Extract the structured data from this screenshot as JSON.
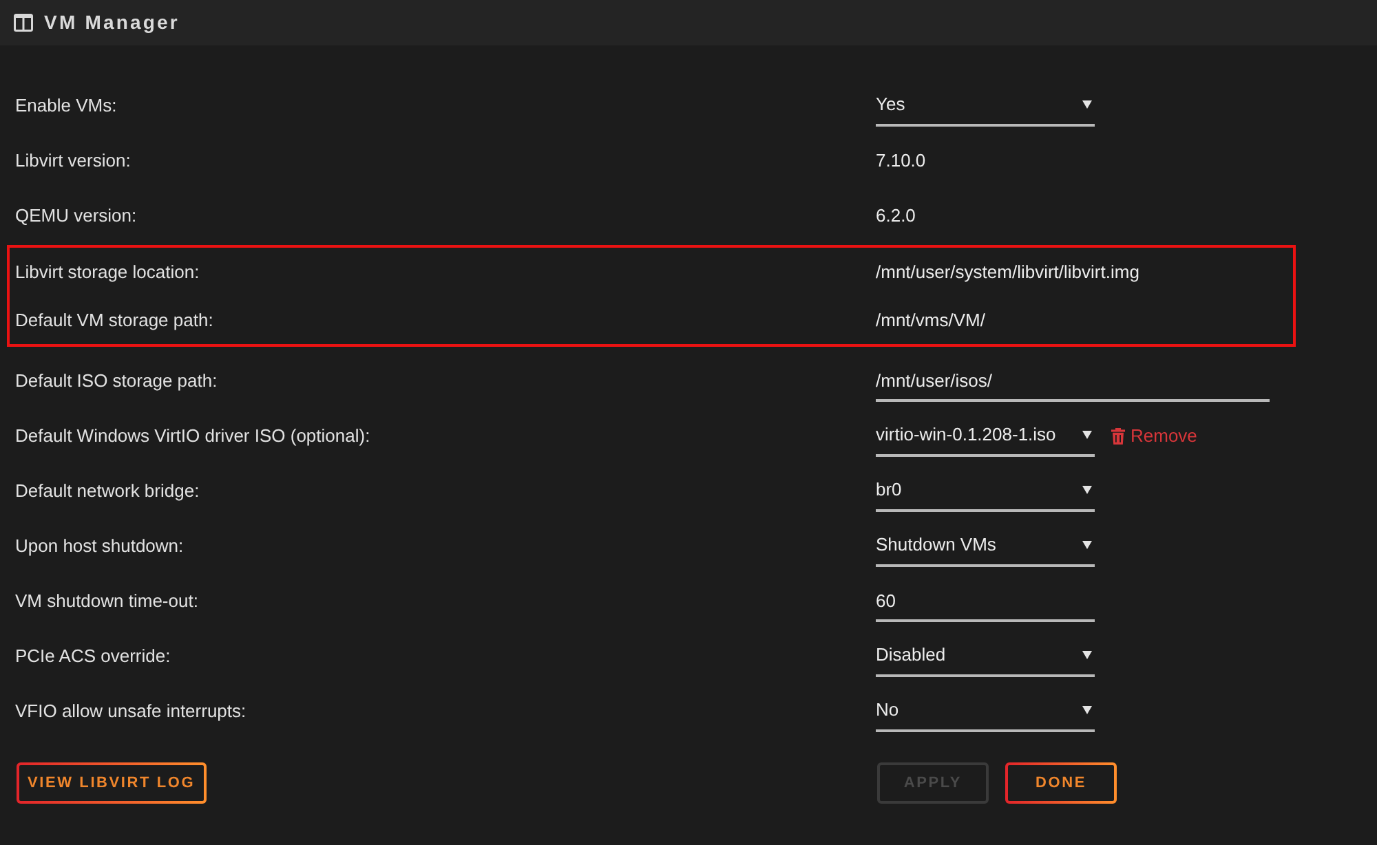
{
  "header": {
    "title": "VM Manager"
  },
  "settings": [
    {
      "label": "Enable VMs:",
      "kind": "select",
      "value": "Yes",
      "highlighted": false
    },
    {
      "label": "Libvirt version:",
      "kind": "static",
      "value": "7.10.0",
      "highlighted": false
    },
    {
      "label": "QEMU version:",
      "kind": "static",
      "value": "6.2.0",
      "highlighted": false
    },
    {
      "label": "Libvirt storage location:",
      "kind": "static",
      "value": "/mnt/user/system/libvirt/libvirt.img",
      "highlighted": true
    },
    {
      "label": "Default VM storage path:",
      "kind": "static",
      "value": "/mnt/vms/VM/",
      "highlighted": true
    },
    {
      "label": "Default ISO storage path:",
      "kind": "path",
      "value": "/mnt/user/isos/",
      "highlighted": false
    },
    {
      "label": "Default Windows VirtIO driver ISO (optional):",
      "kind": "select",
      "value": "virtio-win-0.1.208-1.iso",
      "highlighted": false,
      "action": {
        "label": "Remove"
      }
    },
    {
      "label": "Default network bridge:",
      "kind": "select",
      "value": "br0",
      "highlighted": false
    },
    {
      "label": "Upon host shutdown:",
      "kind": "select",
      "value": "Shutdown VMs",
      "highlighted": false
    },
    {
      "label": "VM shutdown time-out:",
      "kind": "input",
      "value": "60",
      "highlighted": false
    },
    {
      "label": "PCIe ACS override:",
      "kind": "select",
      "value": "Disabled",
      "highlighted": false
    },
    {
      "label": "VFIO allow unsafe interrupts:",
      "kind": "select",
      "value": "No",
      "highlighted": false
    }
  ],
  "buttons_left": [
    {
      "label": "VIEW LIBVIRT LOG",
      "disabled": false
    }
  ],
  "buttons_right": [
    {
      "label": "APPLY",
      "disabled": true
    },
    {
      "label": "DONE",
      "disabled": false
    }
  ]
}
